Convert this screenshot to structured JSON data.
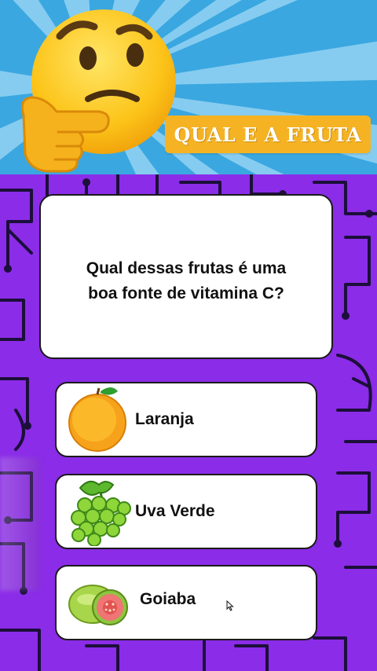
{
  "header": {
    "title_badge": "QUAL E A FRUTA",
    "emoji_icon": "thinking-face-icon",
    "colors": {
      "sky": "#3aa7e0",
      "rays": "#8fd1f2",
      "badge": "#f5b323"
    }
  },
  "question": {
    "text": "Qual dessas frutas é uma boa fonte de vitamina C?"
  },
  "options": [
    {
      "label": "Laranja",
      "icon": "orange-icon"
    },
    {
      "label": "Uva Verde",
      "icon": "green-grapes-icon"
    },
    {
      "label": "Goiaba",
      "icon": "guava-icon"
    }
  ],
  "board": {
    "background": "#8b2ce8",
    "line_color": "#1c0f3a"
  }
}
